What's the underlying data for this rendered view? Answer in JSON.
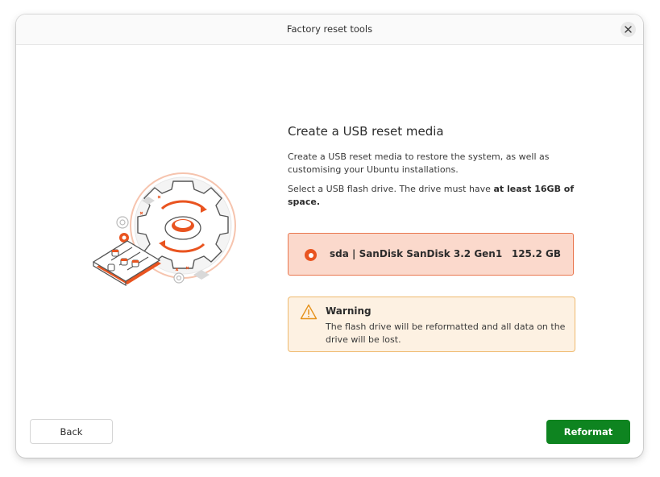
{
  "window": {
    "title": "Factory reset tools",
    "close_icon": "close-icon"
  },
  "main": {
    "heading": "Create a USB reset media",
    "description": "Create a USB reset media to restore the system, as well as customising your Ubuntu installations.",
    "select_text": "Select a USB flash drive. The drive must have ",
    "select_bold": "at least 16GB of space.",
    "drives": [
      {
        "name": "sda | SanDisk SanDisk 3.2 Gen1",
        "size": "125.2 GB",
        "selected": true
      }
    ],
    "warning": {
      "icon": "warning-icon",
      "title": "Warning",
      "text": "The flash drive will be reformatted and all data on the drive will be lost."
    }
  },
  "footer": {
    "back_label": "Back",
    "reformat_label": "Reformat"
  },
  "colors": {
    "accent": "#e95420",
    "selection_bg": "#fbd9cc",
    "warning_bg": "#fdf1e2",
    "warning_border": "#efb96d",
    "primary_button": "#0e8420"
  }
}
